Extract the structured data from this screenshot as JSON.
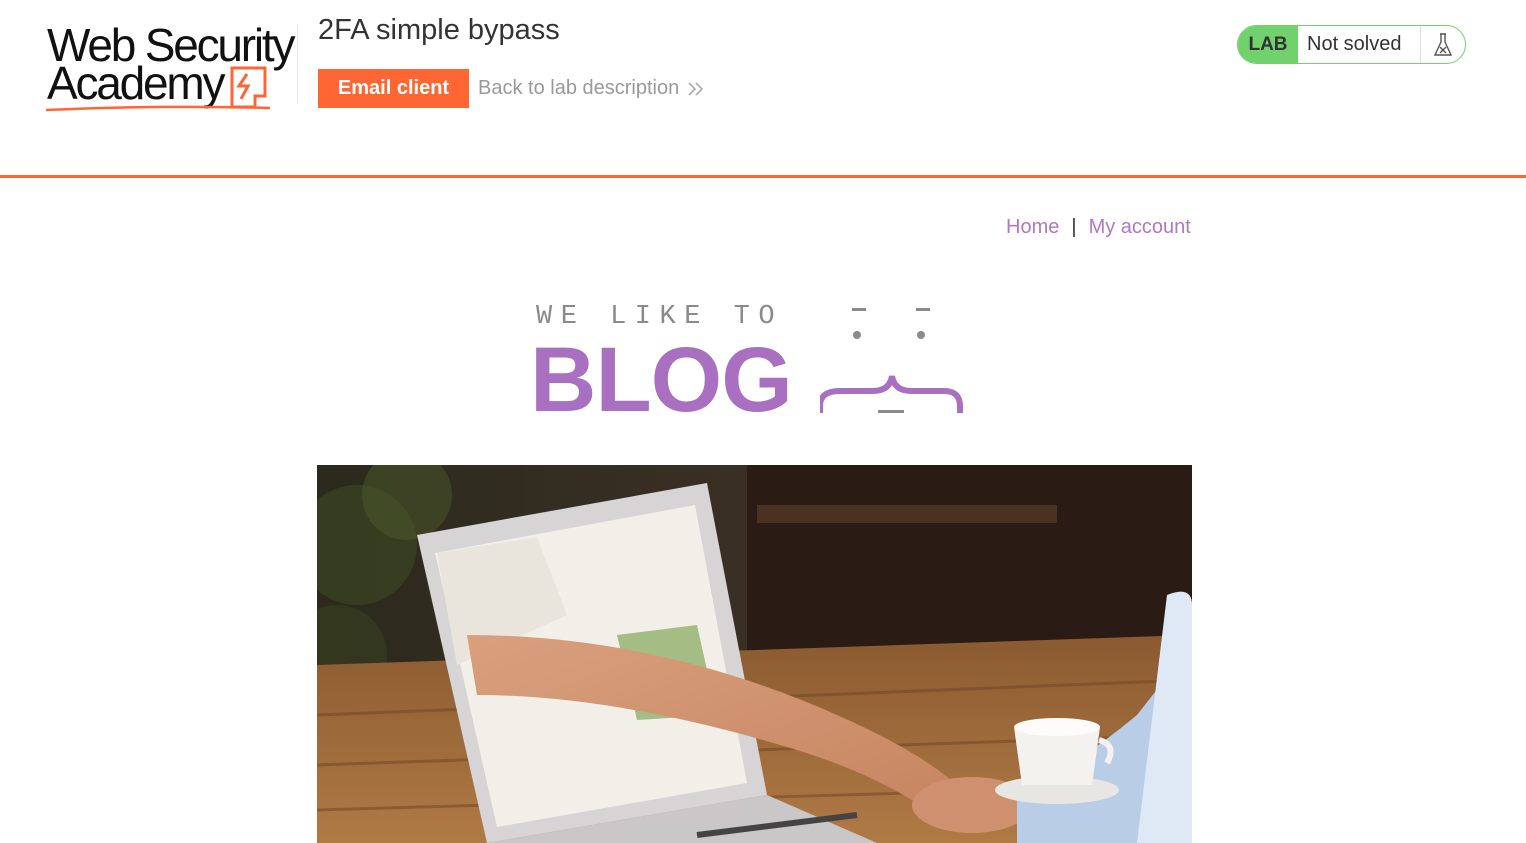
{
  "academy": {
    "logo_line1": "Web Security",
    "logo_line2": "Academy",
    "lab_title": "2FA simple bypass",
    "email_client_label": "Email client",
    "back_link_label": "Back to lab description",
    "back_link_icon": "double-chevron-right-icon",
    "lab_badge": "LAB",
    "lab_status": "Not solved",
    "status_icon": "flask-icon",
    "accent_color": "#ff6633",
    "status_color": "#70d16d"
  },
  "nav": {
    "home_label": "Home",
    "separator": "|",
    "account_label": "My account",
    "link_color": "#b277c4"
  },
  "blog_logo": {
    "tagline": "WE LIKE TO",
    "word": "BLOG",
    "brand_color": "#a96fc0"
  },
  "hero": {
    "alt": "Handshake between a person reaching out of a laptop screen and a person at a cafe table"
  }
}
